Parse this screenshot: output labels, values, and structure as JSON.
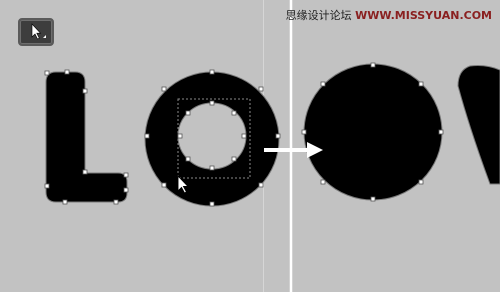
{
  "watermark": {
    "text_cn": "思缘设计论坛",
    "text_en": "WWW.MISSYUAN.COM"
  },
  "toolbar": {
    "tool_icon": "direct-selection-arrow-icon"
  },
  "canvas": {
    "background": "#c2c2c2",
    "artwork_color": "#000000",
    "guide_color": "#ffffff",
    "anchor_color": "#ffffff"
  }
}
